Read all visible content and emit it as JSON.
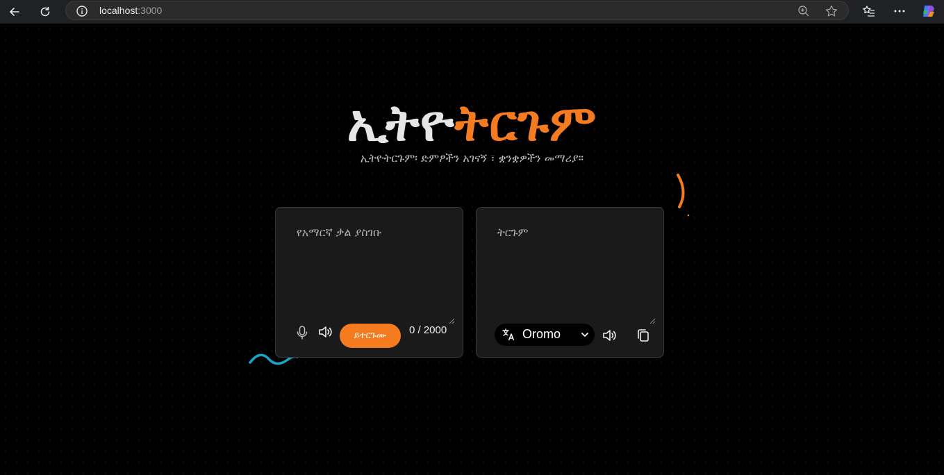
{
  "browser": {
    "url_host": "localhost",
    "url_port": ":3000"
  },
  "header": {
    "title_part1": "ኢትዮ",
    "title_part2": "ትርጉም",
    "subtitle": "ኢትዮትርጉም፡ ድምፆችን አገናኝ ፣ ቋንቋዎችን መማሪያ።"
  },
  "input_panel": {
    "placeholder": "የአማርኛ ቃል ያስገቡ",
    "value": "",
    "translate_label": "ይተርጉሙ",
    "counter": "0 / 2000"
  },
  "output_panel": {
    "placeholder": "ትርጉም",
    "value": "",
    "language": "Oromo"
  },
  "colors": {
    "accent": "#f57b20",
    "background": "#000000",
    "card": "#1a1a1a",
    "wave": "#1ba3c7"
  },
  "icons": {
    "mic": "microphone-icon",
    "speaker": "speaker-icon",
    "copy": "copy-icon",
    "translate": "translate-icon"
  }
}
